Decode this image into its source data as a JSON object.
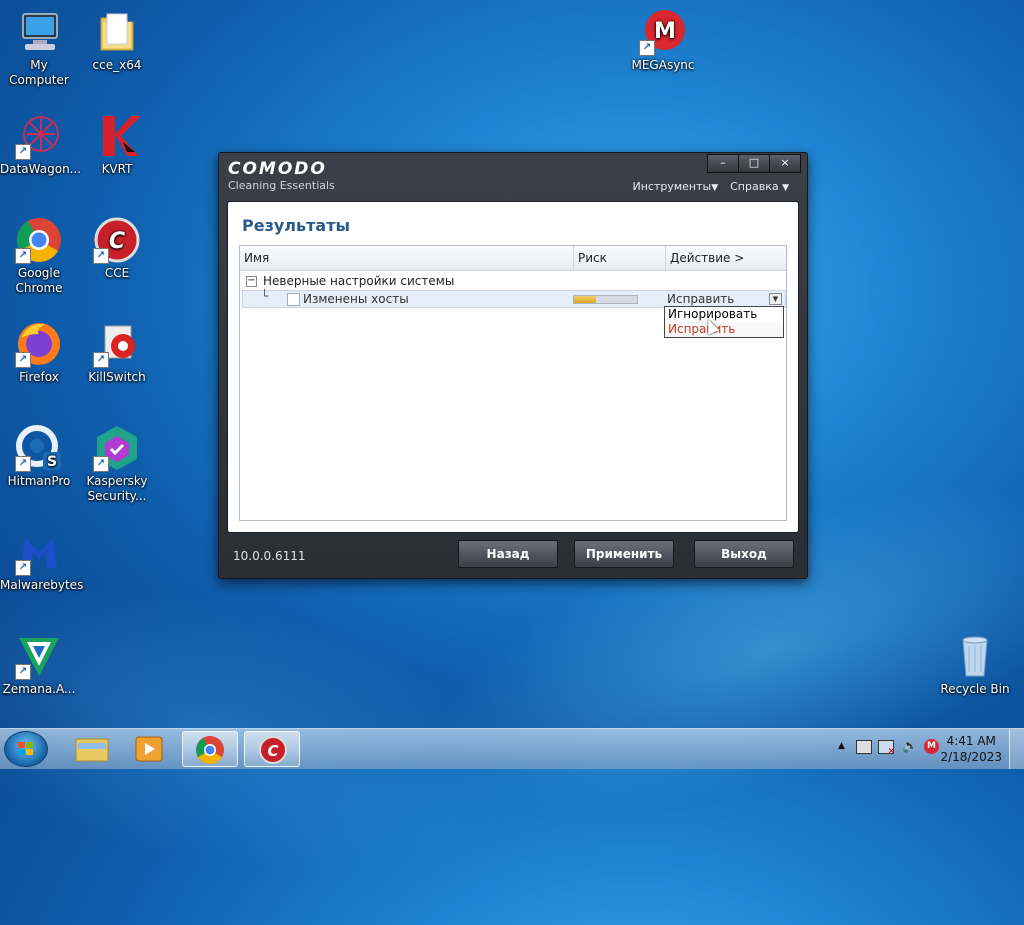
{
  "desktop": {
    "icons": [
      {
        "label": "My Computer"
      },
      {
        "label": "cce_x64"
      },
      {
        "label": "MEGAsync"
      },
      {
        "label": "DataWagon..."
      },
      {
        "label": "KVRT"
      },
      {
        "label": "Google Chrome"
      },
      {
        "label": "CCE"
      },
      {
        "label": "Firefox"
      },
      {
        "label": "KillSwitch"
      },
      {
        "label": "HitmanPro"
      },
      {
        "label": "Kaspersky Security..."
      },
      {
        "label": "Malwarebytes"
      },
      {
        "label": "Zemana.A..."
      },
      {
        "label": "Recycle Bin"
      }
    ]
  },
  "window": {
    "brand": "COMODO",
    "subtitle": "Cleaning Essentials",
    "controls": {
      "minimize": "–",
      "maximize": "□",
      "close": "×"
    },
    "menu": {
      "tools": "Инструменты",
      "help": "Справка"
    },
    "panel_title": "Результаты",
    "columns": {
      "name": "Имя",
      "risk": "Риск",
      "action": "Действие >"
    },
    "group": {
      "label": "Неверные настройки системы"
    },
    "row": {
      "name": "Изменены хосты",
      "risk_level": 0.35,
      "action": "Исправить"
    },
    "dropdown_options": [
      "Игнорировать",
      "Исправить"
    ],
    "version": "10.0.0.6111",
    "buttons": {
      "back": "Назад",
      "apply": "Применить",
      "exit": "Выход"
    }
  },
  "taskbar": {
    "clock_time": "4:41 AM",
    "clock_date": "2/18/2023"
  },
  "colors": {
    "accent": "#2a5a8a",
    "selected_option": "#c0392b"
  }
}
